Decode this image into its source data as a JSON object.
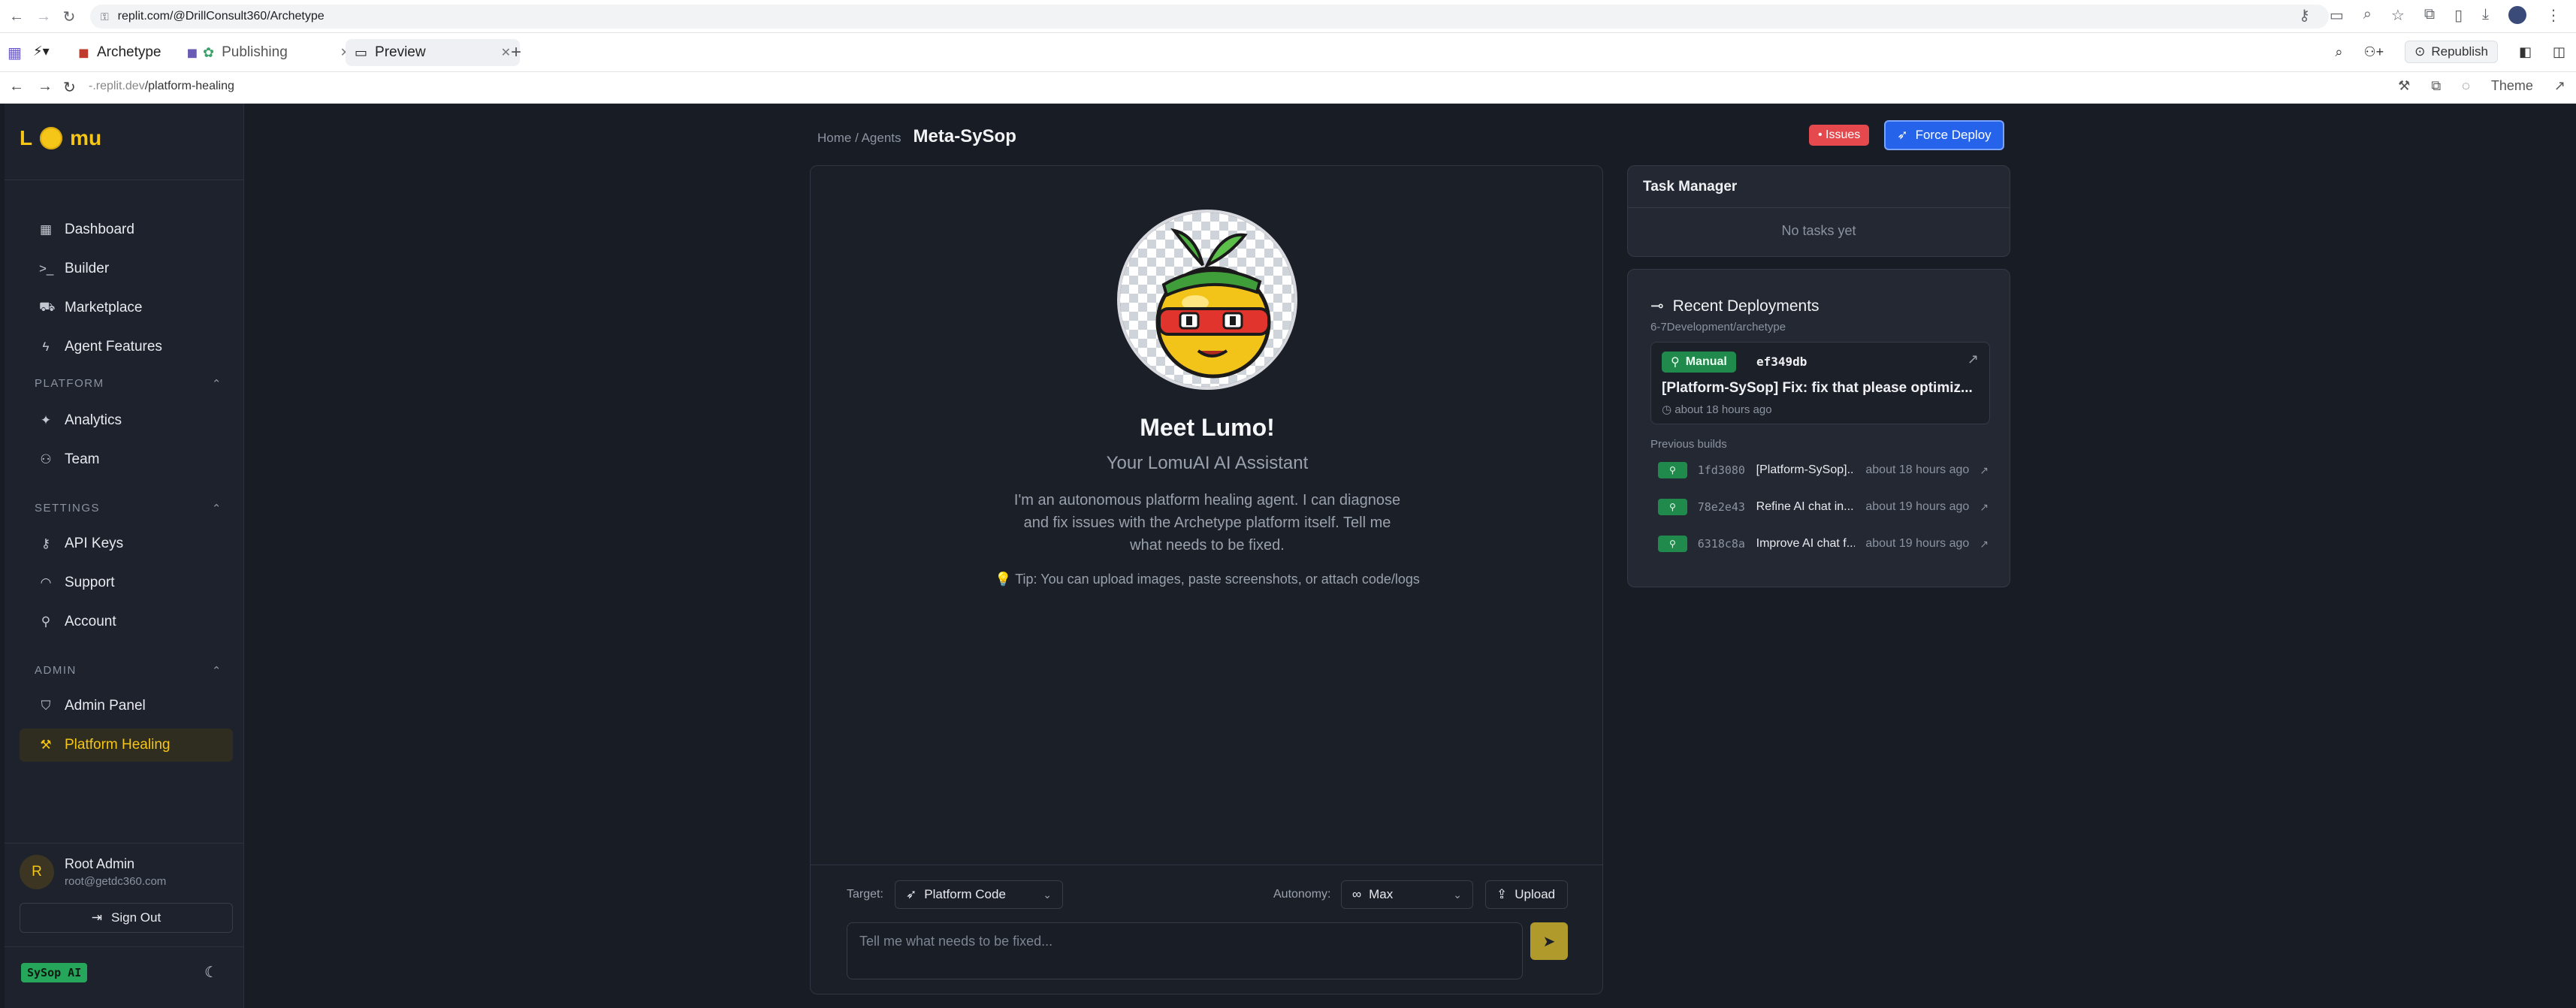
{
  "browser": {
    "url": "replit.com/@DrillConsult360/Archetype"
  },
  "replit": {
    "tabs": [
      {
        "label": "Archetype"
      },
      {
        "label": "Publishing"
      },
      {
        "label": "Preview"
      }
    ],
    "republish_label": "Republish"
  },
  "preview": {
    "url_prefix": "-.replit.dev",
    "url_path": "/platform-healing",
    "theme_label": "Theme"
  },
  "sidebar": {
    "logo_left": "L",
    "logo_right": "mu",
    "items_main": [
      {
        "label": "Dashboard",
        "icon": "dashboard-icon"
      },
      {
        "label": "Builder",
        "icon": "terminal-icon"
      },
      {
        "label": "Marketplace",
        "icon": "cart-icon"
      },
      {
        "label": "Agent Features",
        "icon": "bolt-icon"
      }
    ],
    "sections": [
      {
        "label": "PLATFORM",
        "items": [
          {
            "label": "Analytics"
          },
          {
            "label": "Team"
          }
        ]
      },
      {
        "label": "SETTINGS",
        "items": [
          {
            "label": "API Keys"
          },
          {
            "label": "Support"
          },
          {
            "label": "Account"
          }
        ]
      },
      {
        "label": "ADMIN",
        "items": [
          {
            "label": "Admin Panel"
          },
          {
            "label": "Platform Healing"
          }
        ]
      }
    ],
    "user": {
      "initial": "R",
      "name": "Root Admin",
      "email": "root@getdc360.com"
    },
    "signout_label": "Sign Out",
    "badge": "SySop AI"
  },
  "main": {
    "breadcrumb": "Home / Agents",
    "title": "Meta-SySop",
    "issues_label": "• Issues",
    "deploy_label": "Force Deploy",
    "chat": {
      "heading": "Meet Lumo!",
      "subheading": "Your LomuAI AI Assistant",
      "description": "I'm an autonomous platform healing agent. I can diagnose and fix issues with the Archetype platform itself. Tell me what needs to be fixed.",
      "tip": "💡 Tip: You can upload images, paste screenshots, or attach code/logs",
      "target_label": "Target:",
      "target_value": "Platform Code",
      "autonomy_label": "Autonomy:",
      "autonomy_value": "Max",
      "upload_label": "Upload",
      "placeholder": "Tell me what needs to be fixed..."
    }
  },
  "tasks": {
    "title": "Task Manager",
    "empty": "No tasks yet"
  },
  "deployments": {
    "title": "Recent Deployments",
    "path": "6-7Development/archetype",
    "latest": {
      "badge": "Manual",
      "hash": "ef349db",
      "message": "[Platform-SySop] Fix: fix that please optimiz...",
      "time": "about 18 hours ago"
    },
    "previous_label": "Previous builds",
    "builds": [
      {
        "hash": "1fd3080",
        "message": "[Platform-SySop]...",
        "time": "about 18 hours ago"
      },
      {
        "hash": "78e2e43",
        "message": "Refine AI chat in...",
        "time": "about 19 hours ago"
      },
      {
        "hash": "6318c8a",
        "message": "Improve AI chat f...",
        "time": "about 19 hours ago"
      }
    ]
  },
  "colors": {
    "accent": "#f5c518",
    "background": "#181c25",
    "deploy": "#2563eb",
    "issues": "#e5484d",
    "success": "#1f8a4c"
  }
}
